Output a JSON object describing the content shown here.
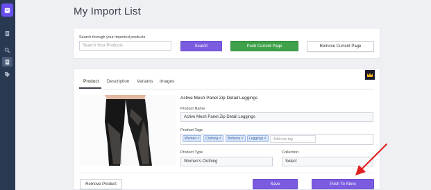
{
  "sidebar": {
    "items": [
      {
        "icon": "doc-icon"
      },
      {
        "icon": "search-icon"
      },
      {
        "icon": "list-icon",
        "active": true
      },
      {
        "icon": "tag-icon"
      }
    ]
  },
  "page": {
    "title": "My Import List"
  },
  "search": {
    "label": "Search through your imported products",
    "placeholder": "Search Your Products",
    "search_button": "Search",
    "push_page_button": "Push Current Page",
    "remove_page_button": "Remove Current Page"
  },
  "product": {
    "tabs": [
      {
        "label": "Product",
        "active": true
      },
      {
        "label": "Description"
      },
      {
        "label": "Variants"
      },
      {
        "label": "Images"
      }
    ],
    "heading": "Active Mesh Panel Zip Detail Leggings",
    "name_label": "Product Name",
    "name_value": "Active Mesh Panel Zip Detail Leggings",
    "tags_label": "Product Tags",
    "tags": [
      "Women",
      "Clothing",
      "Bottoms",
      "Leggings"
    ],
    "tag_placeholder": "Add new tag",
    "type_label": "Product Type",
    "type_value": "Women's Clothing",
    "collection_label": "Collection",
    "collection_value": "Select",
    "remove_button": "Remove Product",
    "save_button": "Save",
    "push_button": "Push To Store"
  },
  "colors": {
    "sidebar": "#2a3952",
    "accent_purple": "#7b5ce0",
    "accent_green": "#3fa14a",
    "annotation_arrow": "#e02020"
  }
}
